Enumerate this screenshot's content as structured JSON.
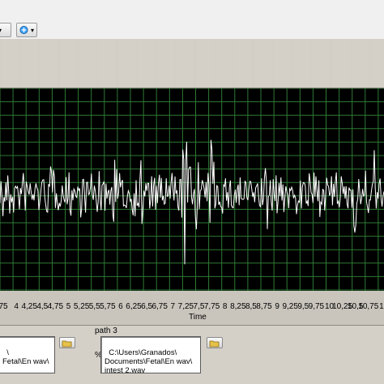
{
  "toolbar": {
    "left_button_arrow": "▾",
    "right_button_arrow": "▾"
  },
  "graph": {
    "x_axis_label": "Time",
    "x_tick_labels": [
      "75",
      "4",
      "4,25",
      "4,5",
      "4,75",
      "5",
      "5,25",
      "5,5",
      "5,75",
      "6",
      "6,25",
      "6,5",
      "6,75",
      "7",
      "7,25",
      "7,5",
      "7,75",
      "8",
      "8,25",
      "8,5",
      "8,75",
      "9",
      "9,25",
      "9,5",
      "9,75",
      "10",
      "10,25",
      "10,5",
      "10,75",
      "1"
    ],
    "colors": {
      "background": "#000000",
      "grid": "#2e7a34",
      "signal": "#ffffff"
    }
  },
  "paths": {
    "left_box_text": "\\\nFetal\\En wav\\",
    "right_label": "path 3",
    "right_box_text": "C:\\Users\\Granados\\\nDocuments\\Fetal\\En wav\\\nintest 2.wav",
    "percent_symbol": "%"
  }
}
